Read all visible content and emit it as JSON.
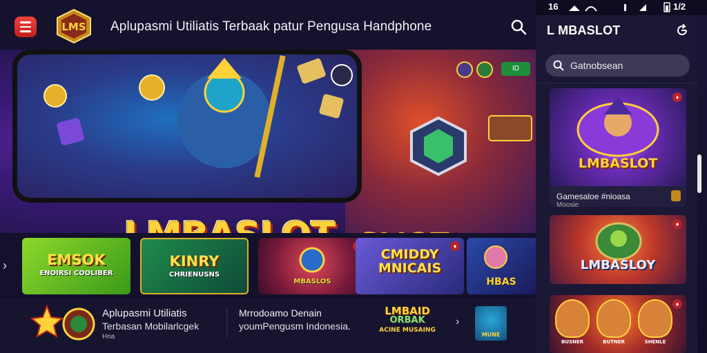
{
  "header": {
    "title": "Aplupasmi Utiliatis Terbaak patur Pengusa Handphone",
    "logo_text": "LMS"
  },
  "hero": {
    "logo_main": "LMBASLOT",
    "logo_secondary": "SLIOT",
    "pill_badge": "ID"
  },
  "game_cards": [
    {
      "title": "EMSOK",
      "subtitle": "ENOIRSI COOLIBER"
    },
    {
      "title": "KINRY",
      "subtitle": "CHRIENUSNS"
    },
    {
      "title": "",
      "subtitle": "MBASLOS"
    },
    {
      "title": "CMIDDY MNICAIS",
      "subtitle": ""
    },
    {
      "title": "",
      "subtitle": "HBAS"
    }
  ],
  "footer": {
    "line1": "Aplupasmi Utiliatis",
    "line2": "Terbasan Mobilarlcgek",
    "line3": "Hna",
    "line4": "Mrrodoamo Denain",
    "line5": "youmPengusm Indonesia.",
    "brand_l1": "LMBAID",
    "brand_l2": "ORBAK",
    "brand_l3": "ACINE MUSAING",
    "thumb_label": "MUNE"
  },
  "status_bar": {
    "time_left": "16",
    "time_right": "1/2"
  },
  "panel": {
    "title": "L MBASLOT",
    "search_placeholder": "Gatnobsean",
    "card1_logo": "LMBASLOT",
    "card1_caption": "Gamesaloe #nioasa",
    "card1_subcaption": "Moosie",
    "card2_logo": "LMBASLOY",
    "card3_labels": [
      "BUSNER",
      "BUTNER",
      "SHENLE"
    ]
  },
  "colors": {
    "accent_red": "#e03a33",
    "gold": "#ffd23a",
    "panel_bg": "#1a1835"
  }
}
